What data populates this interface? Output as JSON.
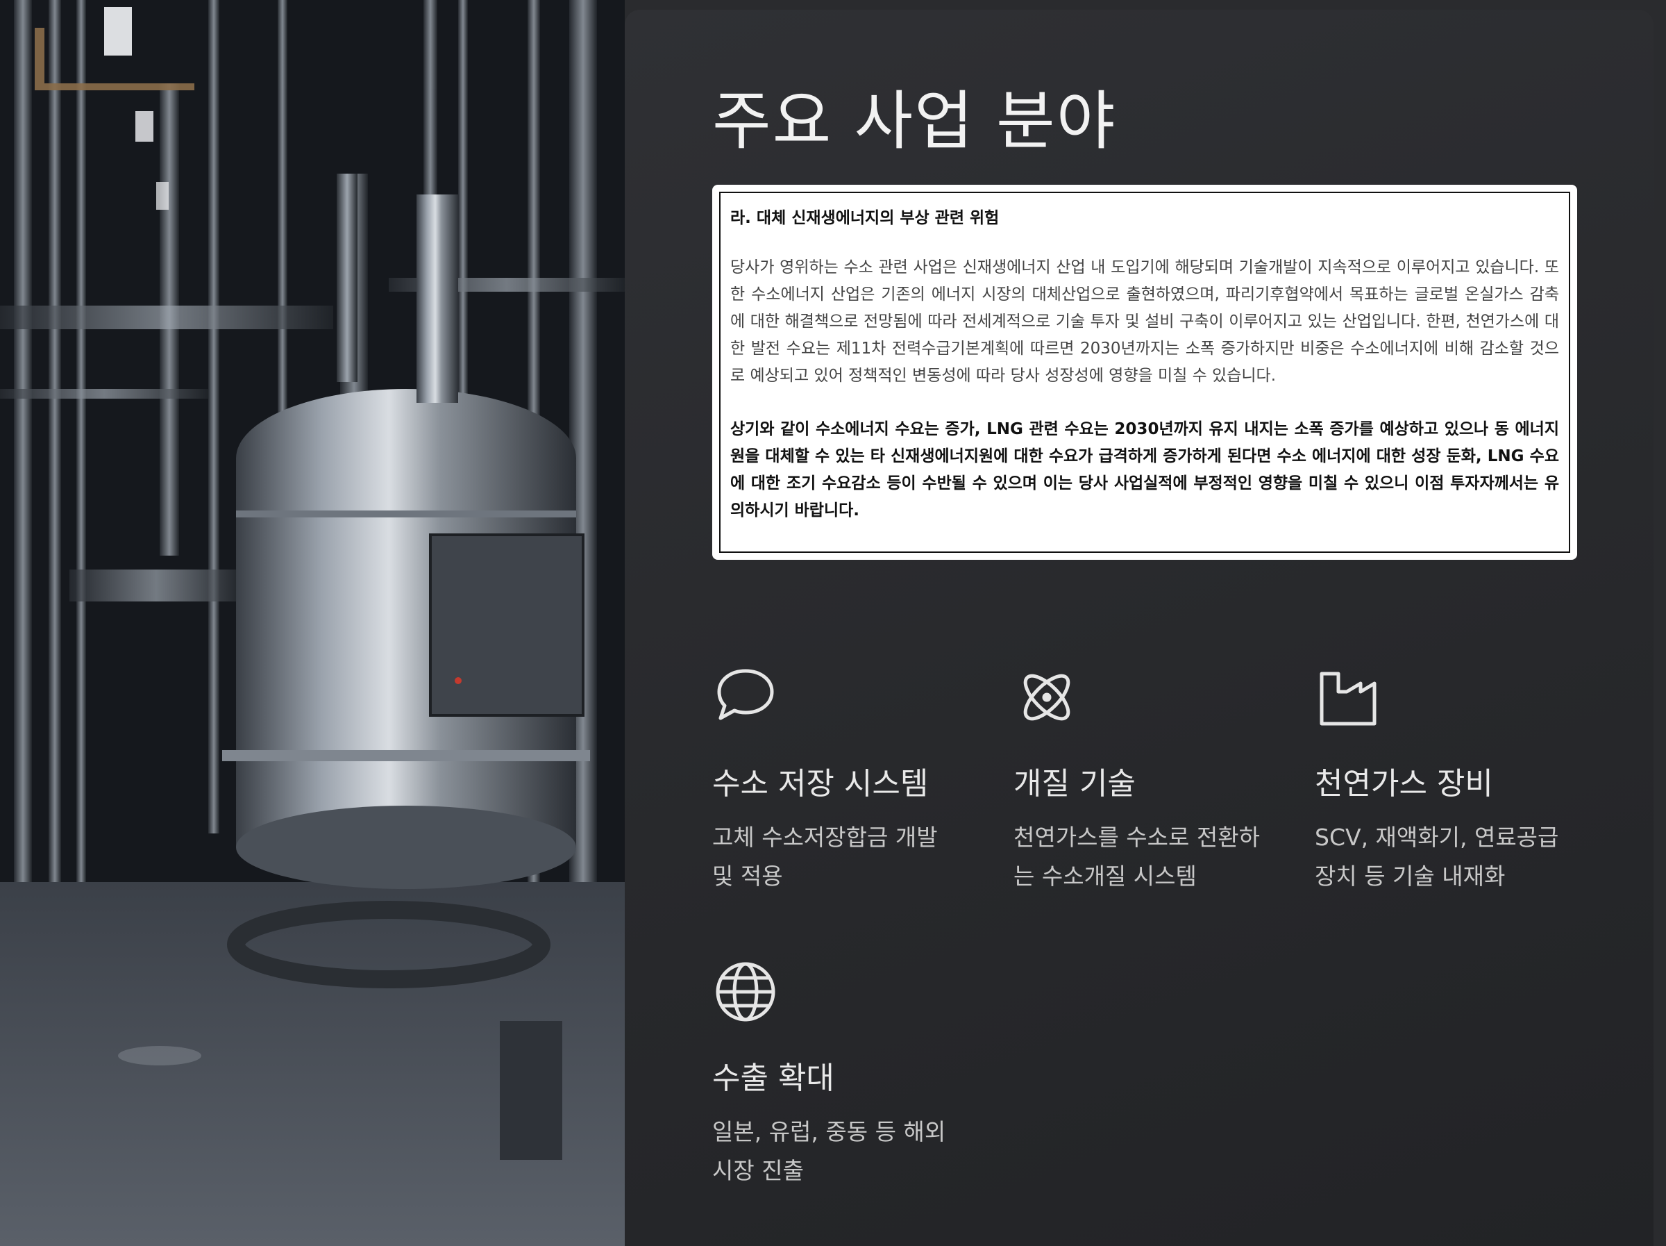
{
  "page": {
    "title": "주요 사업 분야"
  },
  "notice": {
    "heading": "라. 대체 신재생에너지의 부상 관련 위험",
    "paragraph": "당사가 영위하는 수소 관련 사업은 신재생에너지 산업 내 도입기에 해당되며 기술개발이 지속적으로 이루어지고 있습니다. 또한 수소에너지 산업은 기존의 에너지 시장의 대체산업으로 출현하였으며, 파리기후협약에서 목표하는 글로벌 온실가스 감축에 대한 해결책으로 전망됨에 따라 전세계적으로 기술 투자 및 설비 구축이 이루어지고 있는 산업입니다. 한편, 천연가스에 대한 발전 수요는 제11차 전력수급기본계획에 따르면 2030년까지는 소폭 증가하지만 비중은 수소에너지에 비해 감소할 것으로 예상되고 있어 정책적인 변동성에 따라 당사 성장성에 영향을 미칠 수 있습니다.",
    "bold_paragraph": "상기와 같이 수소에너지 수요는 증가, LNG 관련 수요는 2030년까지 유지 내지는 소폭 증가를 예상하고 있으나 동 에너지원을 대체할 수 있는 타 신재생에너지원에 대한 수요가 급격하게 증가하게 된다면 수소 에너지에 대한 성장 둔화, LNG 수요에 대한 조기 수요감소 등이 수반될 수 있으며 이는 당사 사업실적에 부정적인 영향을 미칠 수 있으니 이점 투자자께서는 유의하시기 바랍니다."
  },
  "features": [
    {
      "icon": "chat-bubble-icon",
      "title": "수소 저장 시스템",
      "desc_line1": "고체 수소저장합금 개발",
      "desc_line2": "및 적용"
    },
    {
      "icon": "atom-icon",
      "title": "개질 기술",
      "desc_line1": "천연가스를 수소로 전환하",
      "desc_line2": "는 수소개질 시스템"
    },
    {
      "icon": "factory-icon",
      "title": "천연가스 장비",
      "desc_line1": "SCV, 재액화기, 연료공급",
      "desc_line2": "장치 등 기술 내재화"
    },
    {
      "icon": "globe-icon",
      "title": "수출 확대",
      "desc_line1": "일본, 유럽, 중동 등 해외",
      "desc_line2": "시장 진출"
    }
  ],
  "colors": {
    "panel_bg": "#2a2b2e",
    "title": "#f2f2f2",
    "feature_title": "#e9e9e9",
    "feature_desc": "#c8c8c8",
    "icon_stroke": "#e6e6e6"
  },
  "hero_image": "industrial-plant-with-steel-tank-and-pipes"
}
